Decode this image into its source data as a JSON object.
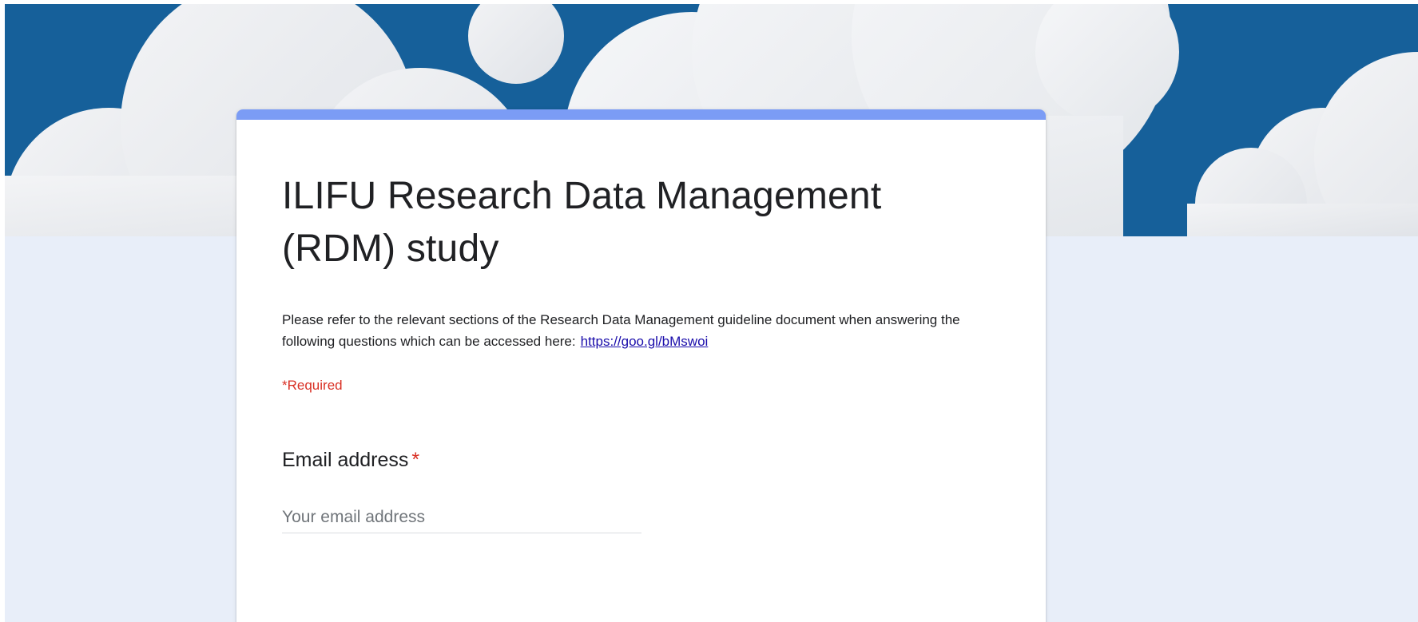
{
  "theme": {
    "header_color": "#16609a",
    "background_color": "#e8eef9",
    "accent_color": "#7b9cf5",
    "required_color": "#d93025",
    "link_color": "#1a0dab"
  },
  "header": {
    "decoration": "clouds-illustration"
  },
  "form": {
    "title": "ILIFU Research Data Management (RDM) study",
    "description_text": "Please refer to the relevant sections of the Research Data Management guideline document when answering the following questions which can be accessed here:",
    "description_link": "https://goo.gl/bMswoi",
    "required_note": "*Required"
  },
  "questions": [
    {
      "title": "Email address",
      "required_marker": "*",
      "placeholder": "Your email address",
      "value": ""
    }
  ]
}
